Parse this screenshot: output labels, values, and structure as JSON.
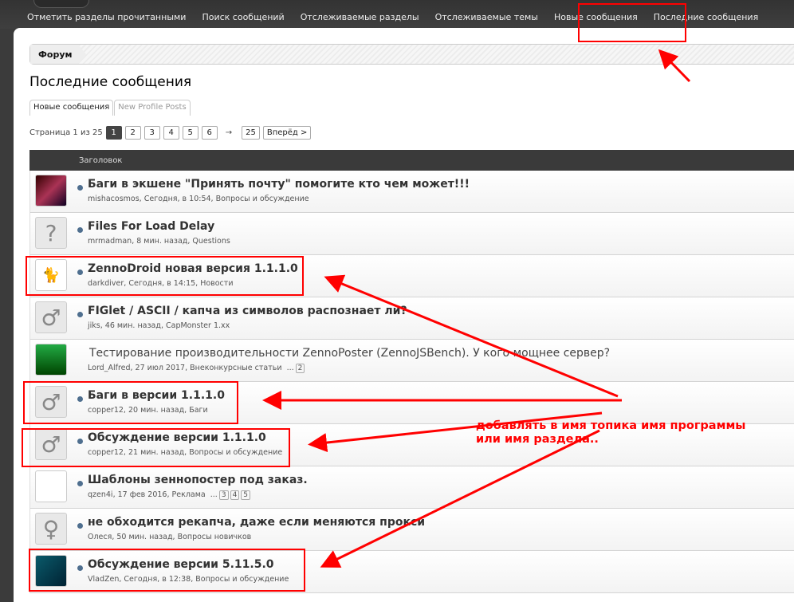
{
  "nav": {
    "items": [
      "Отметить разделы прочитанными",
      "Поиск сообщений",
      "Отслеживаемые разделы",
      "Отслеживаемые темы",
      "Новые сообщения",
      "Последние сообщения"
    ]
  },
  "breadcrumb": "Форум",
  "page_title": "Последние сообщения",
  "tabs": [
    "Новые сообщения",
    "New Profile Posts"
  ],
  "pager": {
    "label": "Страница 1 из 25",
    "pages": [
      "1",
      "2",
      "3",
      "4",
      "5",
      "6"
    ],
    "arrow": "→",
    "last": "25",
    "next": "Вперёд >"
  },
  "table": {
    "header": "Заголовок",
    "rows": [
      {
        "title": "Баги в экшене \"Принять почту\" помогите кто чем может!!!",
        "meta": "mishacosmos, Сегодня, в 10:54, Вопросы и обсуждение",
        "avatar": "photo"
      },
      {
        "title": "Files For Load Delay",
        "meta": "mrmadman, 8 мин. назад, Questions",
        "avatar": "?"
      },
      {
        "title": "ZennoDroid новая версия 1.1.1.0",
        "meta": "darkdiver, Сегодня, в 14:15, Новости",
        "avatar": "cat"
      },
      {
        "title": "FIGlet / ASCII / капча из символов распознает ли?",
        "meta": "jiks, 46 мин. назад, CapMonster 1.xx",
        "avatar": "♂"
      },
      {
        "title": "Тестирование производительности ZennoPoster (ZennoJSBench). У кого мощнее сервер?",
        "meta": "Lord_Alfred, 27 июл 2017, Внеконкурсные статьи",
        "ellipsis": "...",
        "pages": [
          "2"
        ],
        "avatar": "eagle",
        "read": true
      },
      {
        "title": "Баги в версии 1.1.1.0",
        "meta": "copper12, 20 мин. назад, Баги",
        "avatar": "♂"
      },
      {
        "title": "Обсуждение версии 1.1.1.0",
        "meta": "copper12, 21 мин. назад, Вопросы и обсуждение",
        "avatar": "♂"
      },
      {
        "title": "Шаблоны зеннопостер под заказ.",
        "meta": "qzen4i, 17 фев 2016, Реклама",
        "ellipsis": "...",
        "pages": [
          "3",
          "4",
          "5"
        ],
        "avatar": "drawing"
      },
      {
        "title": "не обходится рекапча, даже если меняются прокси",
        "meta": "Олеся, 50 мин. назад, Вопросы новичков",
        "avatar": "♀"
      },
      {
        "title": "Обсуждение версии 5.11.5.0",
        "meta": "VladZen, Сегодня, в 12:38, Вопросы и обсуждение",
        "avatar": "guitar"
      }
    ]
  },
  "annotation": {
    "line1": "добавлять в имя топика имя программы",
    "line2": "или имя раздела..",
    "color": "#ff0000"
  }
}
